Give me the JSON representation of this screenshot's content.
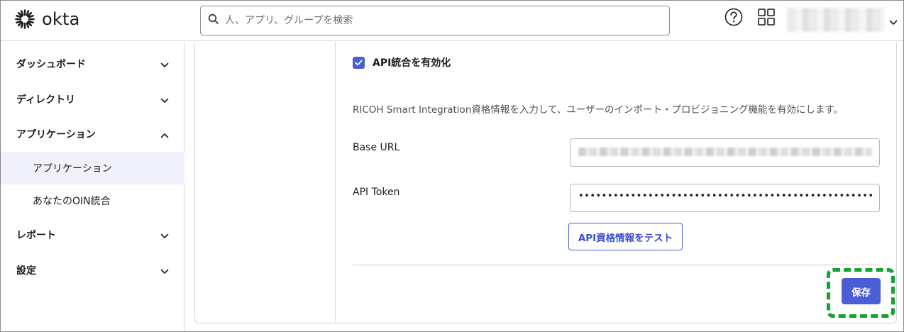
{
  "header": {
    "logo_text": "okta",
    "search_placeholder": "人、アプリ、グループを検索",
    "icons": [
      "okta-logo-icon",
      "search-icon",
      "help-icon",
      "app-grid-icon",
      "chevron-down-icon"
    ]
  },
  "sidebar": {
    "items": [
      {
        "label": "ダッシュボード",
        "state": "collapsed"
      },
      {
        "label": "ディレクトリ",
        "state": "collapsed"
      },
      {
        "label": "アプリケーション",
        "state": "expanded"
      },
      {
        "label": "レポート",
        "state": "collapsed"
      },
      {
        "label": "設定",
        "state": "collapsed"
      }
    ],
    "sub_items": [
      {
        "label": "アプリケーション",
        "active": true
      },
      {
        "label": "あなたのOIN統合",
        "active": false
      }
    ]
  },
  "main": {
    "enable_checkbox": {
      "label": "API統合を有効化",
      "checked": true
    },
    "description": "RICOH Smart Integration資格情報を入力して、ユーザーのインポート・プロビジョニング機能を有効にします。",
    "fields": {
      "base_url": {
        "label": "Base URL"
      },
      "api_token": {
        "label": "API Token",
        "masked_value": "••••••••••••••••••••••••••••••••••••••••••••••••••••••"
      }
    },
    "test_button": "API資格情報をテスト",
    "save_button": "保存"
  },
  "colors": {
    "primary": "#4b5ed6",
    "highlight": "#10a52e",
    "active_bg": "#f0f1fa"
  }
}
